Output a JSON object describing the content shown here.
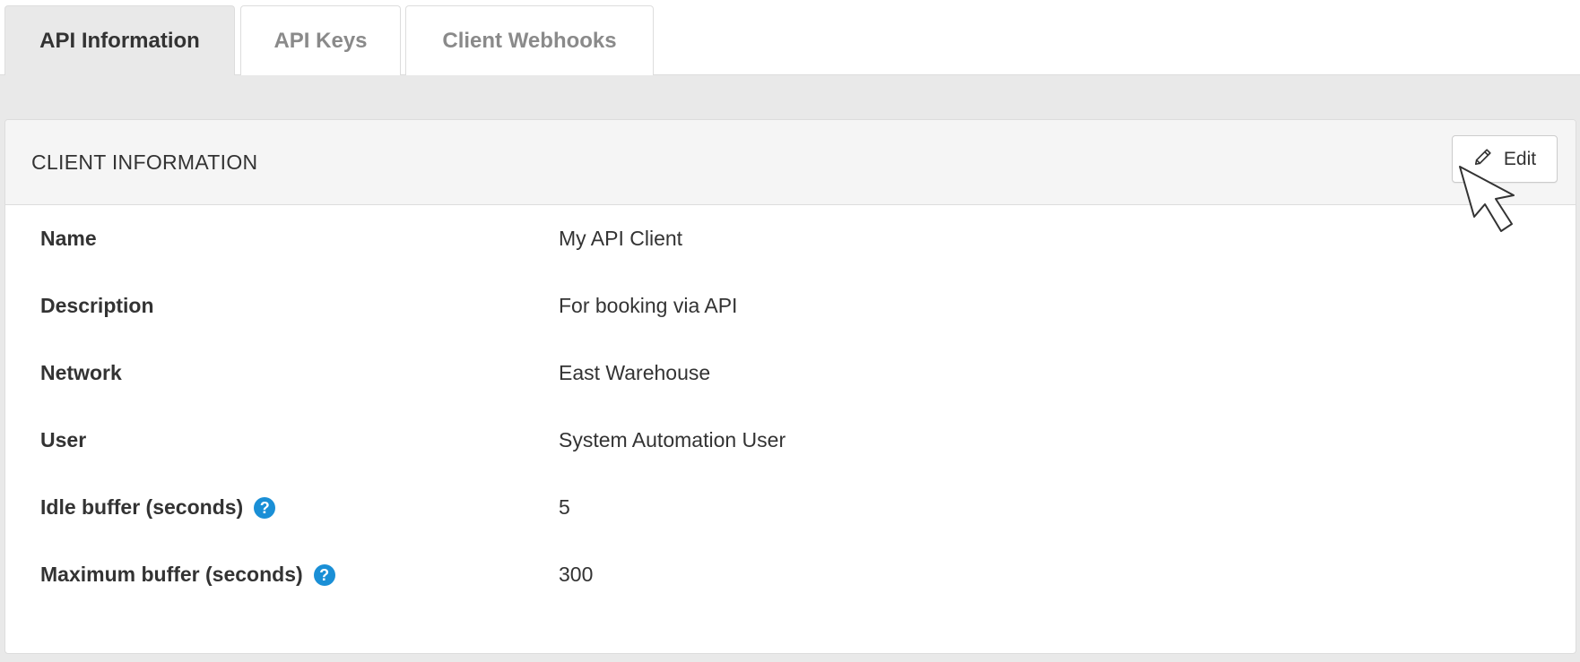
{
  "tabs": [
    {
      "label": "API Information",
      "active": true
    },
    {
      "label": "API Keys",
      "active": false
    },
    {
      "label": "Client Webhooks",
      "active": false
    }
  ],
  "panel": {
    "title": "CLIENT INFORMATION",
    "edit_label": "Edit",
    "edit_icon": "pencil-icon"
  },
  "fields": [
    {
      "label": "Name",
      "value": "My API Client",
      "help": false
    },
    {
      "label": "Description",
      "value": "For booking via API",
      "help": false
    },
    {
      "label": "Network",
      "value": "East Warehouse",
      "help": false
    },
    {
      "label": "User",
      "value": "System Automation User",
      "help": false
    },
    {
      "label": "Idle buffer (seconds)",
      "value": "5",
      "help": true
    },
    {
      "label": "Maximum buffer (seconds)",
      "value": "300",
      "help": true
    }
  ],
  "help_glyph": "?",
  "colors": {
    "accent": "#1a8fd6",
    "background": "#e9e9e9",
    "panel_header": "#f5f5f5"
  }
}
